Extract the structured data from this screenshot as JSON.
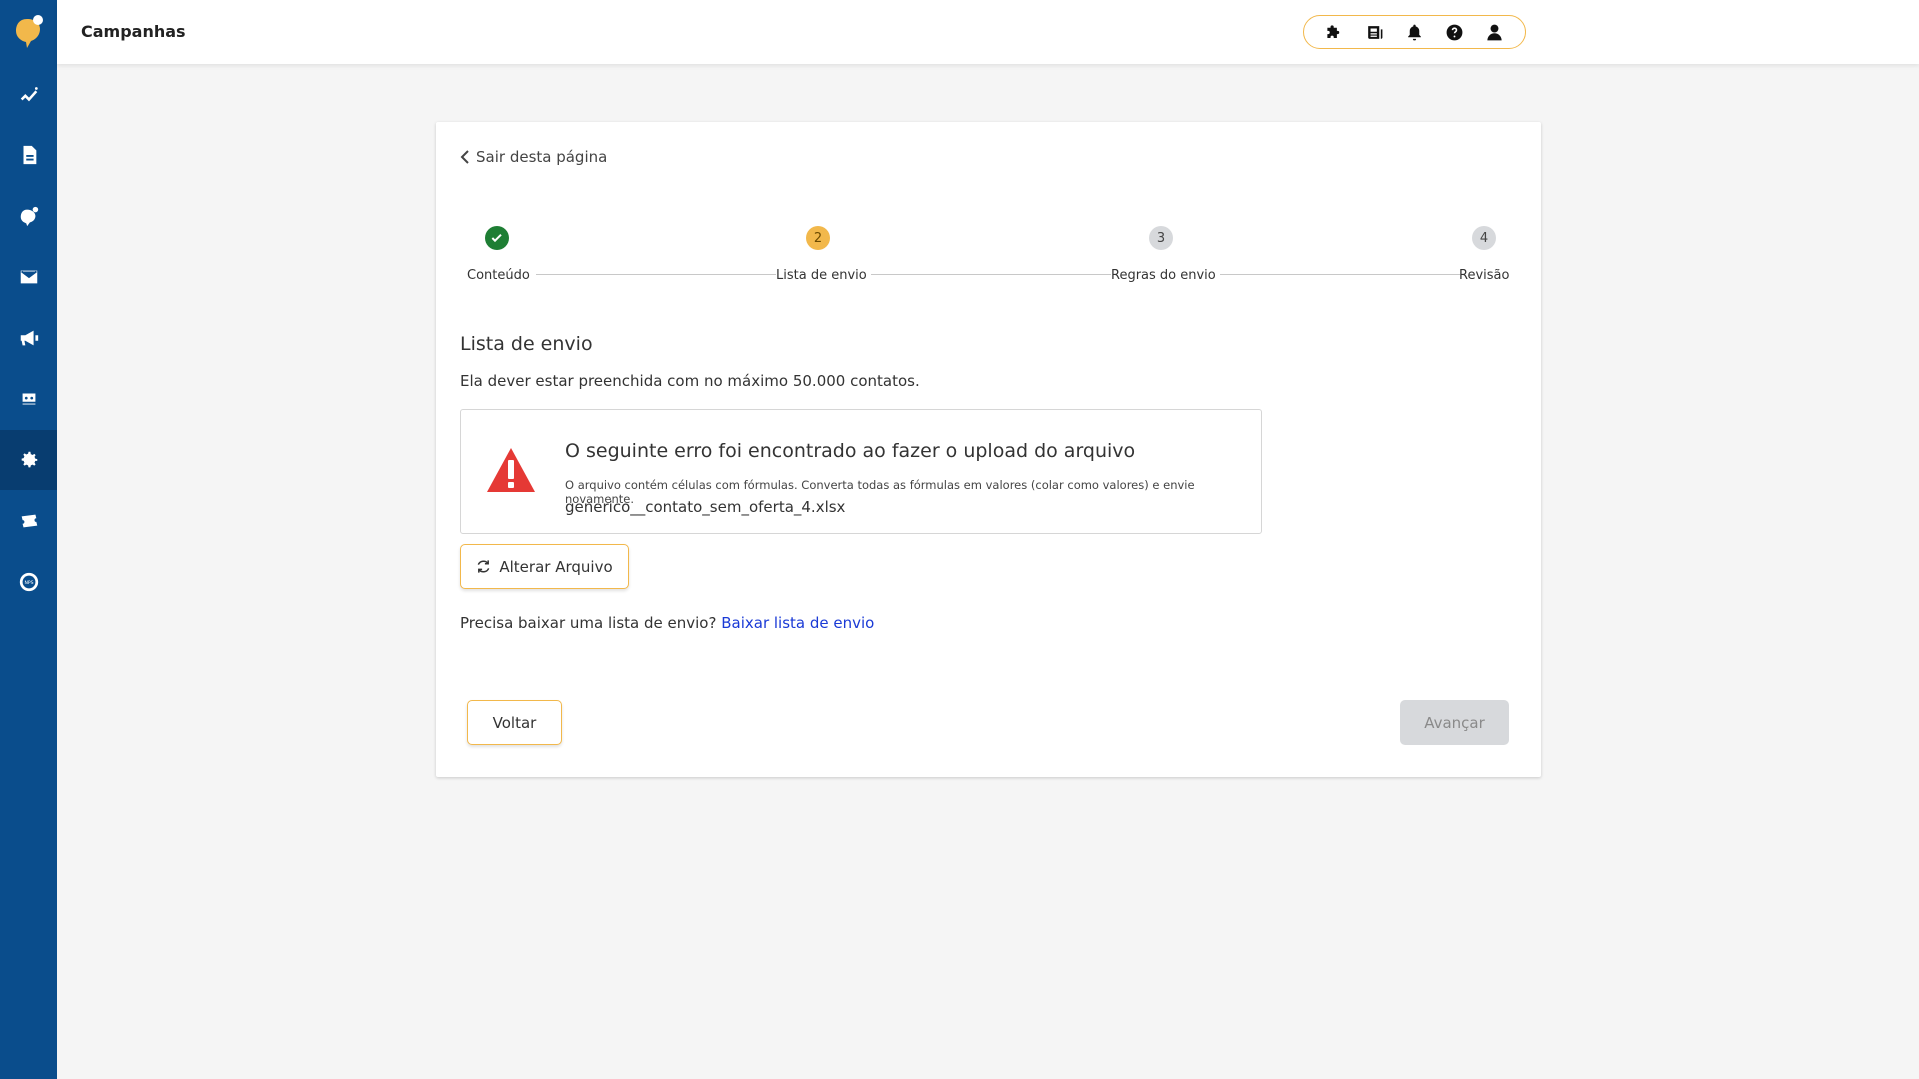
{
  "header": {
    "title": "Campanhas"
  },
  "sidebar": {
    "items": [
      {
        "icon": "chart-line-icon"
      },
      {
        "icon": "document-icon"
      },
      {
        "icon": "logo-bubble-icon"
      },
      {
        "icon": "mail-icon"
      },
      {
        "icon": "megaphone-icon"
      },
      {
        "icon": "bot-icon"
      },
      {
        "icon": "gear-icon",
        "active": true
      },
      {
        "icon": "ticket-icon"
      },
      {
        "icon": "nps-icon"
      }
    ]
  },
  "toolbar": {
    "icons": [
      "puzzle-icon",
      "news-icon",
      "bell-icon",
      "help-icon",
      "user-icon"
    ]
  },
  "page": {
    "back_link": "Sair desta página",
    "steps": [
      {
        "number": "✓",
        "label": "Conteúdo",
        "status": "done"
      },
      {
        "number": "2",
        "label": "Lista de envio",
        "status": "current"
      },
      {
        "number": "3",
        "label": "Regras do envio",
        "status": "pending"
      },
      {
        "number": "4",
        "label": "Revisão",
        "status": "pending"
      }
    ],
    "section_title": "Lista de envio",
    "section_desc": "Ela dever estar preenchida com no máximo 50.000 contatos.",
    "error": {
      "title": "O seguinte erro foi encontrado ao fazer o upload do arquivo",
      "message": "O arquivo contém células com fórmulas. Converta todas as fórmulas em valores (colar como valores) e envie novamente.",
      "filename": "generico__contato_sem_oferta_4.xlsx"
    },
    "change_file_label": "Alterar Arquivo",
    "download_prompt": "Precisa baixar uma lista de envio?",
    "download_link": "Baixar lista de envio",
    "back_button": "Voltar",
    "next_button": "Avançar"
  },
  "colors": {
    "sidebar": "#0a4d8c",
    "accent": "#f2b84b",
    "success": "#1e7e34",
    "error": "#e53935",
    "link": "#1a3ad6"
  }
}
